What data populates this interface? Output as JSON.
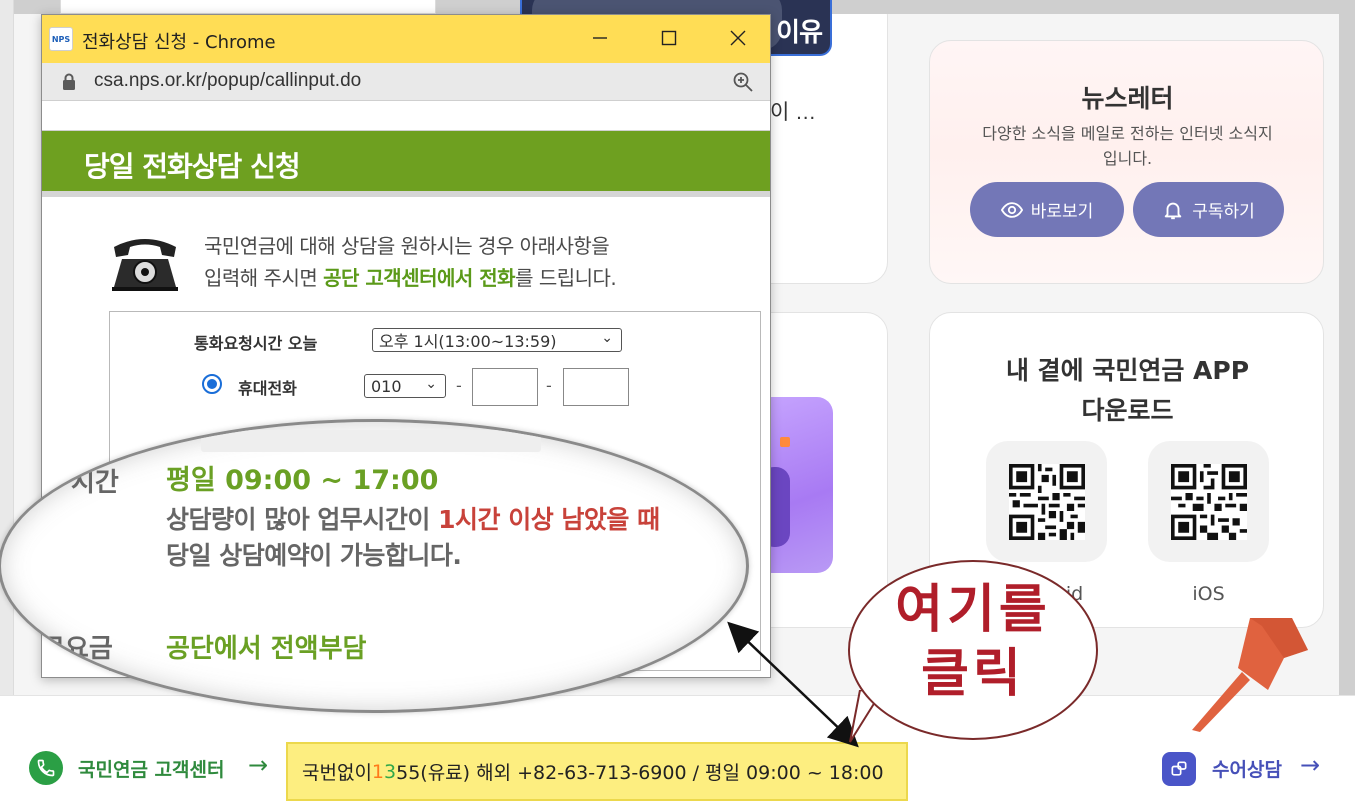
{
  "background": {
    "card_ellipsis": "이 …",
    "thumb_text": "이유",
    "newsletter": {
      "title": "뉴스레터",
      "description": "다양한 소식을 메일로 전하는 인터넷 소식지입니다.",
      "view_button": "바로보기",
      "subscribe_button": "구독하기"
    },
    "app_download": {
      "title_line1": "내 곁에 국민연금 APP",
      "title_line2": "다운로드",
      "android_label": "Android",
      "ios_label": "iOS"
    }
  },
  "bottom_bar": {
    "center_label": "국민연금 고객센터",
    "phone_prefix": "국번없이 ",
    "phone_d1": "1",
    "phone_d2": "3",
    "phone_rest": "55(유료) 해외 +82-63-713-6900 / 평일 09:00 ~ 18:00",
    "sign_label": "수어상담",
    "arrow_glyph": "→"
  },
  "popup": {
    "window_title": "전화상담 신청 - Chrome",
    "favicon_text": "NPS",
    "url": "csa.nps.or.kr/popup/callinput.do",
    "header": "당일 전화상담 신청",
    "intro_line1": "국민연금에 대해 상담을 원하시는 경우 아래사항을",
    "intro_line2_pre": "입력해 주시면 ",
    "intro_line2_hl": "공단 고객센터에서 전화",
    "intro_line2_post": "를 드립니다.",
    "form": {
      "time_label": "통화요청시간 오늘",
      "time_value": "오후 1시(13:00~13:59)",
      "mobile_label": "휴대전화",
      "mobile_prefix": "010",
      "dash": "-"
    }
  },
  "magnifier": {
    "side_label1": "시간",
    "side_label2": "료요금",
    "hours": "평일 09:00 ~ 17:00",
    "desc_pre": "상담량이 많아 업무시간이 ",
    "desc_red": "1시간 이상 남았을 때",
    "desc_line2": "당일 상담예약이 가능합니다.",
    "fee": "공단에서 전액부담"
  },
  "bubble": {
    "line1": "여기를",
    "line2": "클릭"
  },
  "colors": {
    "green_header": "#6ea020",
    "title_bar": "#ffdd55",
    "pill": "#7377b7",
    "pin": "#e0623f",
    "highlight": "#fdee80"
  }
}
